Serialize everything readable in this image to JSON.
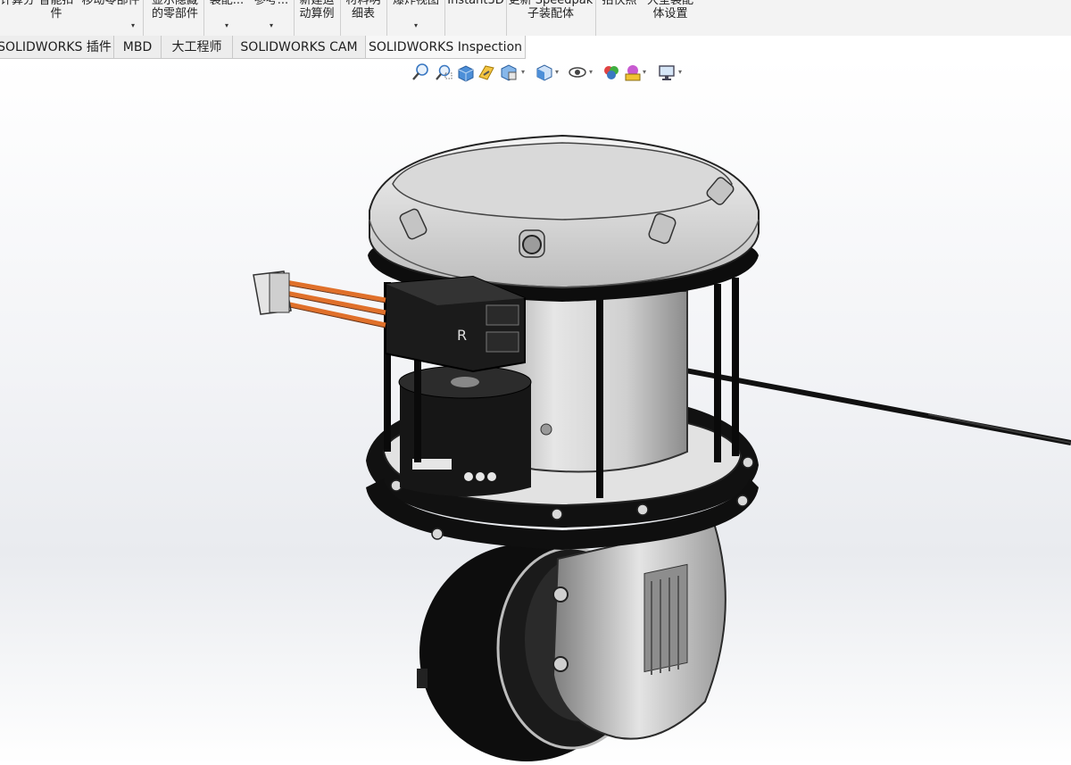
{
  "ribbon": {
    "groups": [
      {
        "l1": "计算分",
        "l2": "",
        "arrow": ""
      },
      {
        "l1": "智能扣",
        "l2": "件",
        "arrow": ""
      },
      {
        "l1": "移动零部件",
        "l2": "",
        "arrow": "▾"
      },
      {
        "l1": "显示隐藏",
        "l2": "的零部件",
        "arrow": ""
      },
      {
        "l1": "装配...",
        "l2": "",
        "arrow": "▾"
      },
      {
        "l1": "参考...",
        "l2": "",
        "arrow": "▾"
      },
      {
        "l1": "新建运",
        "l2": "动算例",
        "arrow": ""
      },
      {
        "l1": "材料明",
        "l2": "细表",
        "arrow": ""
      },
      {
        "l1": "爆炸视图",
        "l2": "",
        "arrow": "▾"
      },
      {
        "l1": "Instant3D",
        "l2": "",
        "arrow": ""
      },
      {
        "l1": "更新 Speedpak",
        "l2": "子装配体",
        "arrow": ""
      },
      {
        "l1": "拍快照",
        "l2": "",
        "arrow": ""
      },
      {
        "l1": "大型装配",
        "l2": "体设置",
        "arrow": ""
      }
    ]
  },
  "tabs": [
    {
      "label": "SOLIDWORKS 插件"
    },
    {
      "label": "MBD"
    },
    {
      "label": "大工程师"
    },
    {
      "label": "SOLIDWORKS CAM"
    },
    {
      "label": "SOLIDWORKS Inspection"
    }
  ],
  "hud": {
    "icons": [
      "zoom-to-fit-icon",
      "zoom-to-area-icon",
      "previous-view-icon",
      "section-view-icon",
      "dynamic-annotation-icon",
      "view-orientation-icon",
      "display-style-icon",
      "hide-show-items-icon",
      "edit-appearance-icon",
      "apply-scene-icon",
      "view-settings-icon"
    ],
    "dropdown_glyph": "▾"
  },
  "colors": {
    "ribbon_bg": "#f3f3f3",
    "tab_bg": "#ededed",
    "model_dark": "#111111",
    "model_gray": "#d4d4d4",
    "cable_orange": "#e0702a"
  }
}
